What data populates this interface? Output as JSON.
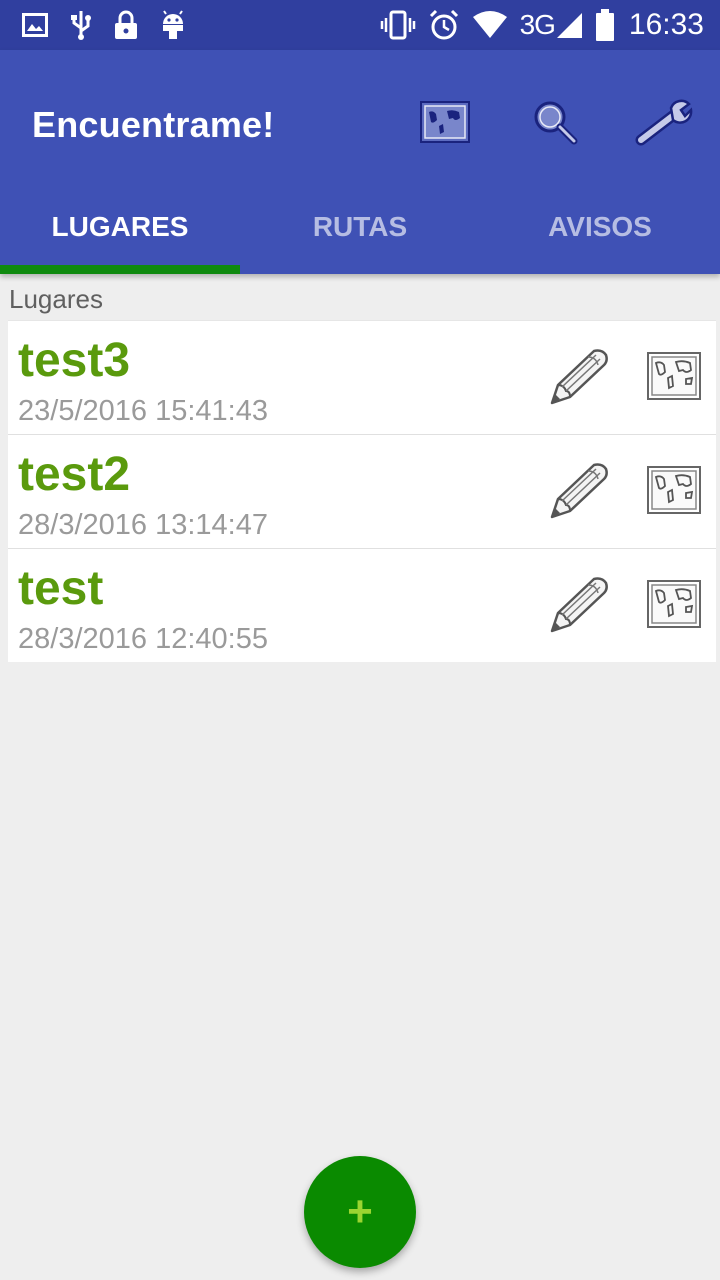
{
  "status_bar": {
    "time": "16:33",
    "network": "3G",
    "left_icons": [
      "image-icon",
      "usb-icon",
      "lock-icon",
      "android-icon"
    ],
    "right_icons": [
      "vibrate-icon",
      "alarm-icon",
      "wifi-icon",
      "signal-icon",
      "battery-icon"
    ]
  },
  "app_bar": {
    "title": "Encuentrame!",
    "actions": [
      "map-icon",
      "search-icon",
      "wrench-icon"
    ],
    "tabs": [
      {
        "label": "LUGARES",
        "active": true
      },
      {
        "label": "RUTAS",
        "active": false
      },
      {
        "label": "AVISOS",
        "active": false
      }
    ]
  },
  "section": {
    "header": "Lugares"
  },
  "places": [
    {
      "name": "test3",
      "date": "23/5/2016 15:41:43"
    },
    {
      "name": "test2",
      "date": "28/3/2016 13:14:47"
    },
    {
      "name": "test",
      "date": "28/3/2016 12:40:55"
    }
  ],
  "fab": {
    "label": "+"
  },
  "colors": {
    "status_bar": "#303f9f",
    "app_bar": "#3f51b5",
    "tab_indicator": "#0f8a0f",
    "item_name": "#5a9a0d",
    "fab": "#0a8a00",
    "fab_plus": "#9bd531"
  }
}
